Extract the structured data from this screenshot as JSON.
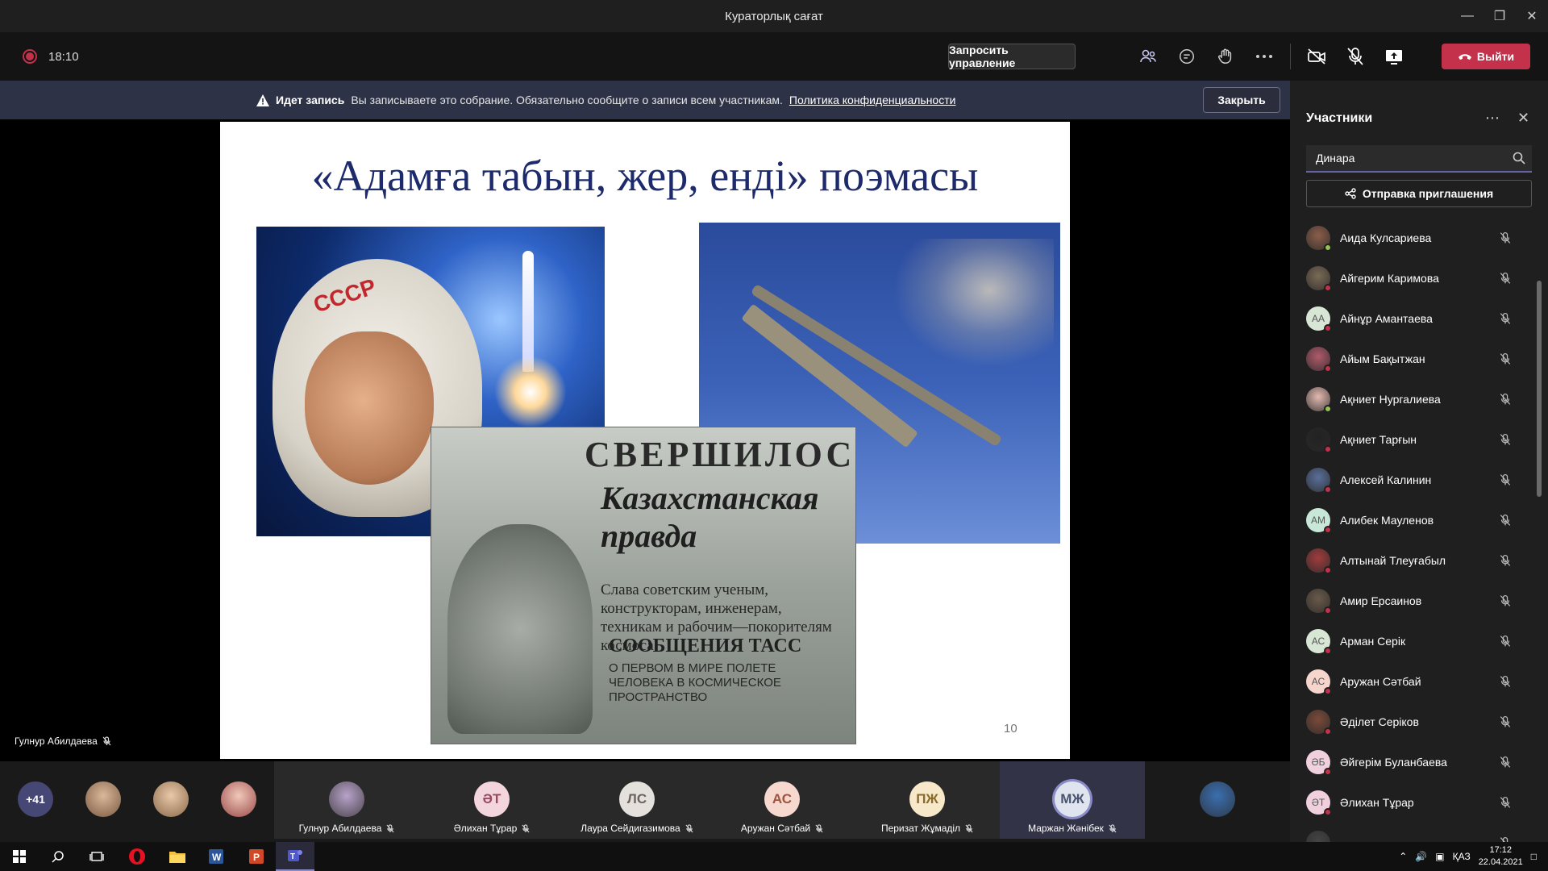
{
  "window": {
    "title": "Кураторлық сағат"
  },
  "toolbar": {
    "timer": "18:10",
    "request_control": "Запросить управление",
    "leave_label": "Выйти"
  },
  "banner": {
    "label": "Идет запись",
    "message": "Вы записываете это собрание. Обязательно сообщите о записи всем участникам.",
    "link": "Политика конфиденциальности",
    "close_label": "Закрыть"
  },
  "slide": {
    "title": "«Адамға табын, жер, енді» поэмасы",
    "helmet_text": "СССР",
    "newspaper_title": "СВЕРШИЛОСЬ!",
    "newspaper_name": "Казахстанская правда",
    "newspaper_lead": "Слава советским ученым, конструкторам, инженерам, техникам и рабочим—покорителям космоса!",
    "newspaper_heading": "СООБЩЕНИЯ ТАСС",
    "newspaper_sub": "О ПЕРВОМ В МИРЕ ПОЛЕТЕ ЧЕЛОВЕКА В КОСМИЧЕСКОЕ ПРОСТРАНСТВО",
    "page_number": "10"
  },
  "presenter": {
    "name": "Гулнур Абилдаева"
  },
  "participants_panel": {
    "title": "Участники",
    "search_value": "Динара",
    "invite_label": "Отправка приглашения",
    "items": [
      {
        "name": "Аида Кулсариева",
        "initials": "",
        "color": "#8b5e4a",
        "status": "#92c353"
      },
      {
        "name": "Айгерим Каримова",
        "initials": "",
        "color": "#7a6a55",
        "status": "#c4314b"
      },
      {
        "name": "Айнұр Амантаева",
        "initials": "АА",
        "color": "#d8e7d5",
        "status": "#c4314b"
      },
      {
        "name": "Айым Бақытжан",
        "initials": "",
        "color": "#b05a6a",
        "status": "#c4314b"
      },
      {
        "name": "Ақниет Нургалиева",
        "initials": "",
        "color": "#e3b9b0",
        "status": "#92c353"
      },
      {
        "name": "Ақниет Тарғын",
        "initials": "",
        "color": "#222222",
        "status": "#c4314b"
      },
      {
        "name": "Алексей Калинин",
        "initials": "",
        "color": "#5a6f9a",
        "status": "#c4314b"
      },
      {
        "name": "Алибек Мауленов",
        "initials": "АМ",
        "color": "#c7e8d8",
        "status": "#c4314b"
      },
      {
        "name": "Алтынай Тлеуғабыл",
        "initials": "",
        "color": "#a03c3c",
        "status": "#c4314b"
      },
      {
        "name": "Амир Ерсаинов",
        "initials": "",
        "color": "#6a5a4a",
        "status": "#c4314b"
      },
      {
        "name": "Арман Серік",
        "initials": "АС",
        "color": "#d8e7d5",
        "status": "#c4314b"
      },
      {
        "name": "Аружан Сәтбай",
        "initials": "АС",
        "color": "#f5d5cc",
        "status": "#c4314b"
      },
      {
        "name": "Әділет Серіков",
        "initials": "",
        "color": "#7a4a3a",
        "status": "#c4314b"
      },
      {
        "name": "Әйгерім Буланбаева",
        "initials": "ӘБ",
        "color": "#f0d0dc",
        "status": "#c4314b"
      },
      {
        "name": "Әлихан Тұрар",
        "initials": "ӘТ",
        "color": "#f0d0dc",
        "status": "#c4314b"
      },
      {
        "name": "",
        "initials": "",
        "color": "#444444",
        "status": "#c4314b"
      }
    ]
  },
  "gallery": {
    "more_count": "+41",
    "tiles": [
      {
        "name": "Гулнур Абилдаева",
        "initials": "",
        "color": "#b8a2c9",
        "text_color": "#333333"
      },
      {
        "name": "Әлихан Тұрар",
        "initials": "ӘТ",
        "color": "#f3d6dd",
        "text_color": "#9a4a5c"
      },
      {
        "name": "Лаура Сейдигазимова",
        "initials": "ЛС",
        "color": "#e4e0dc",
        "text_color": "#6b6360"
      },
      {
        "name": "Аружан Сәтбай",
        "initials": "АС",
        "color": "#f6d8cf",
        "text_color": "#a0533f"
      },
      {
        "name": "Перизат Жұмаділ",
        "initials": "ПЖ",
        "color": "#f6e8c8",
        "text_color": "#8a6a2a"
      },
      {
        "name": "Маржан Жәнібек",
        "initials": "МЖ",
        "color": "#dfe4ee",
        "text_color": "#4a5470"
      },
      {
        "name": "",
        "initials": "",
        "color": "#3a6fb0",
        "text_color": "#ffffff"
      }
    ]
  },
  "taskbar": {
    "lang": "ҚАЗ",
    "time": "17:12",
    "date": "22.04.2021"
  }
}
